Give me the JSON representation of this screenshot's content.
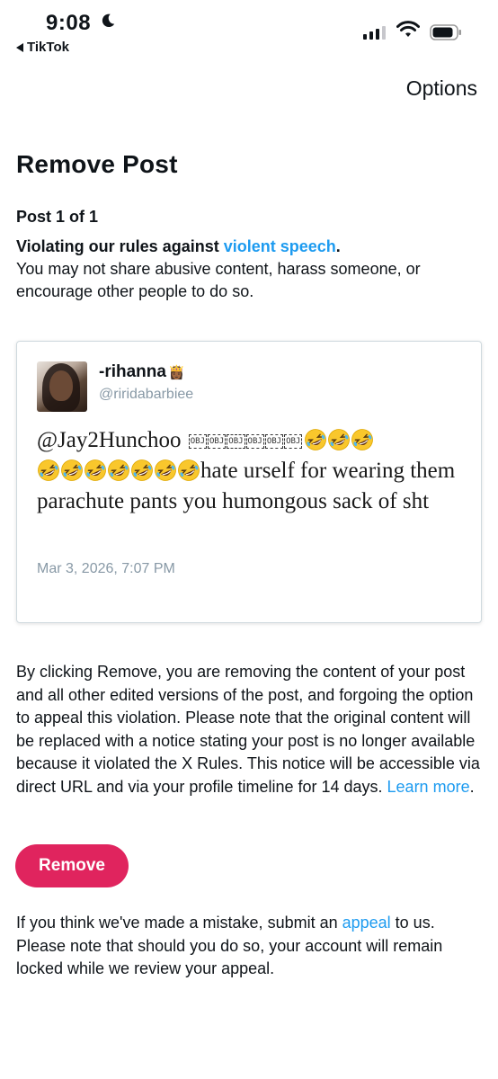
{
  "status_bar": {
    "time": "9:08",
    "back_app": "TikTok"
  },
  "header": {
    "options_label": "Options"
  },
  "page": {
    "title": "Remove Post",
    "post_count": "Post 1 of 1",
    "rule_prefix": "Violating our rules against ",
    "rule_link": "violent speech",
    "rule_suffix": ".",
    "rule_description": "You may not share abusive content, harass someone, or encourage other people to do so."
  },
  "tweet": {
    "display_name": "-rihanna",
    "name_emoji": "👸🏾",
    "handle": "@riridabarbiee",
    "mention": "@Jay2Hunchoo",
    "obj_placeholders": [
      "OBJ",
      "OBJ",
      "OBJ",
      "OBJ",
      "OBJ",
      "OBJ"
    ],
    "emoji_name": "rolling-on-floor-laughing",
    "emoji_count_line1": 3,
    "emoji_count_line2": 7,
    "text_after_emojis": "hate urself for wearing them parachute pants you humongous sack of sht",
    "date": "Mar 3, 2026, 7:07 PM"
  },
  "notice": {
    "text": "By clicking Remove, you are removing the content of your post and all other edited versions of the post, and forgoing the option to appeal this violation. Please note that the original content will be replaced with a notice stating your post is no longer available because it violated the X Rules. This notice will be accessible via direct URL and via your profile timeline for 14 days. ",
    "link": "Learn more",
    "suffix": "."
  },
  "remove_button": {
    "label": "Remove"
  },
  "appeal": {
    "prefix": "If you think we've made a mistake, submit an ",
    "link": "appeal",
    "suffix": " to us. Please note that should you do so, your account will remain locked while we review your appeal."
  },
  "colors": {
    "accent_link": "#1d9bf0",
    "remove_button": "#e0245e",
    "muted_text": "#8899a6"
  }
}
